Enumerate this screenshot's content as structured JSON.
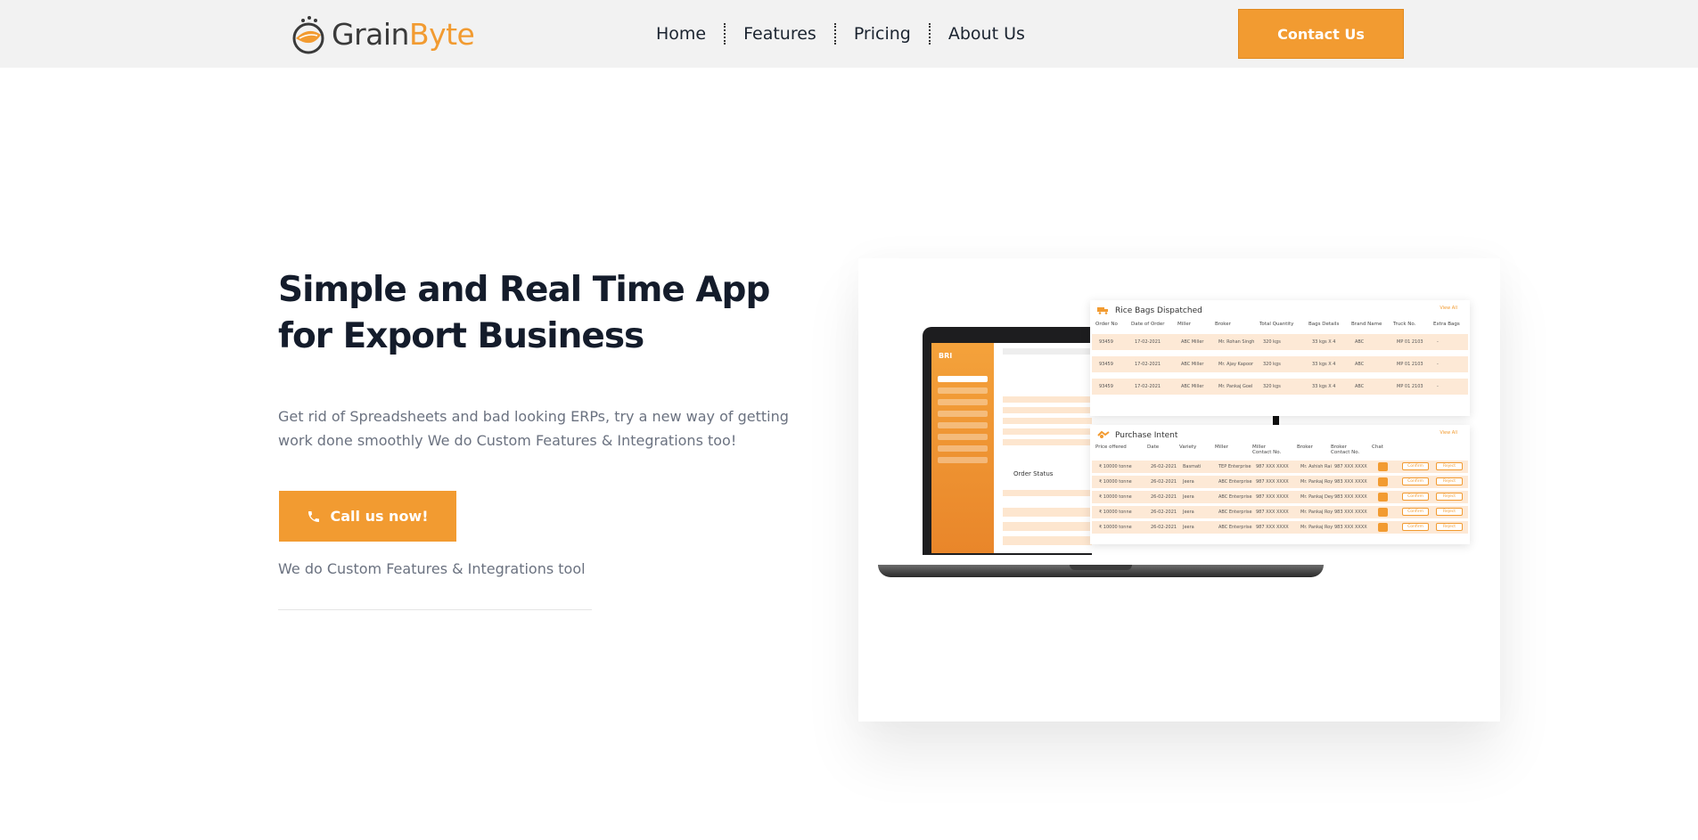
{
  "header": {
    "logo": {
      "part1": "Grain",
      "part2": "Byte"
    },
    "nav": [
      "Home",
      "Features",
      "Pricing",
      "About Us"
    ],
    "contact_label": "Contact Us"
  },
  "hero": {
    "title": "Simple and Real Time App for Export Business",
    "description": "Get rid of Spreadsheets and bad looking ERPs, try a new way of getting work done smoothly We do Custom Features & Integrations too!",
    "cta_label": "Call us now!",
    "note": "We do Custom Features & Integrations tool"
  },
  "preview": {
    "app_sidebar_title": "BRI",
    "order_status_title": "Order Status",
    "rice_bags": {
      "title": "Rice Bags Dispatched",
      "view_all": "View All",
      "columns": [
        "Order No",
        "Date of Order",
        "Miller",
        "Broker",
        "Total Quantity",
        "Bags Details",
        "Brand Name",
        "Truck No.",
        "Extra Bags"
      ],
      "rows": [
        [
          "93459",
          "17-02-2021",
          "ABC Miller",
          "Mr. Rohan Singh",
          "320 kgs",
          "33 kgs X 4",
          "ABC",
          "MP 01 2103",
          "-"
        ],
        [
          "93459",
          "17-02-2021",
          "ABC Miller",
          "Mr. Ajay Kapoor",
          "320 kgs",
          "33 kgs X 4",
          "ABC",
          "MP 01 2103",
          "-"
        ],
        [
          "93459",
          "17-02-2021",
          "ABC Miller",
          "Mr. Pankaj Goel",
          "320 kgs",
          "33 kgs X 4",
          "ABC",
          "MP 01 2103",
          "-"
        ]
      ]
    },
    "purchase_intent": {
      "title": "Purchase Intent",
      "view_all": "View All",
      "columns": [
        "Price offered",
        "Date",
        "Variety",
        "Miller",
        "Miller Contact No.",
        "Broker",
        "Broker Contact No.",
        "Chat"
      ],
      "confirm_label": "Confirm",
      "reject_label": "Reject",
      "rows": [
        [
          "₹ 10000 tonne",
          "26-02-2021",
          "Basmati",
          "TEP Enterprise",
          "987 XXX XXXX",
          "Mr. Ashish Rai",
          "987 XXX XXXX"
        ],
        [
          "₹ 10000 tonne",
          "26-02-2021",
          "Jeera",
          "ABC Enterprise",
          "987 XXX XXXX",
          "Mr. Pankaj Roy",
          "983 XXX XXXX"
        ],
        [
          "₹ 10000 tonne",
          "26-02-2021",
          "Jeera",
          "ABC Enterprise",
          "987 XXX XXXX",
          "Mr. Pankaj Dey",
          "983 XXX XXXX"
        ],
        [
          "₹ 10000 tonne",
          "26-02-2021",
          "Jeera",
          "ABC Enterprise",
          "987 XXX XXXX",
          "Mr. Pankaj Roy",
          "983 XXX XXXX"
        ],
        [
          "₹ 10000 tonne",
          "26-02-2021",
          "Jeera",
          "ABC Enterprise",
          "987 XXX XXXX",
          "Mr. Pankaj Roy",
          "983 XXX XXXX"
        ]
      ]
    }
  },
  "colors": {
    "accent": "#f29b31",
    "header_bg": "#f2f2f2",
    "title": "#141c2b",
    "muted": "#6b7280"
  },
  "icons": {
    "phone": "phone-icon",
    "logo": "grain-leaf-icon"
  }
}
